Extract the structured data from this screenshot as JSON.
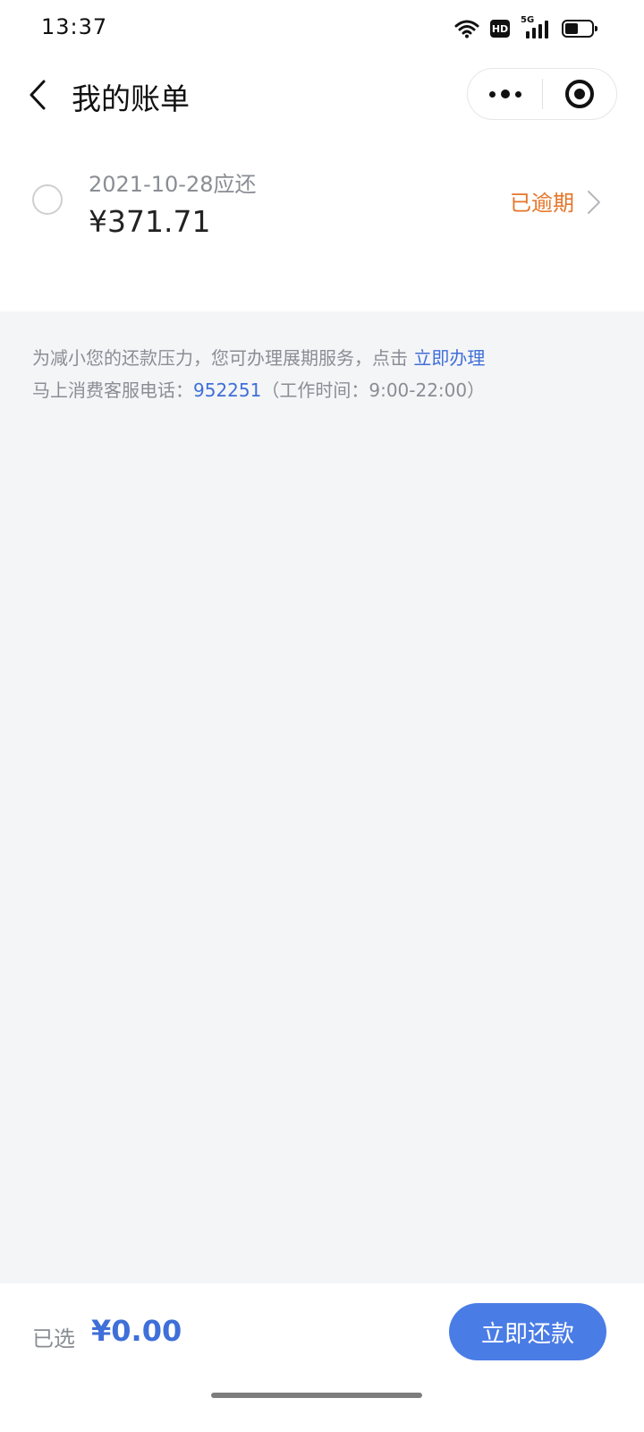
{
  "status_bar": {
    "time": "13:37",
    "icons": [
      "wifi-icon",
      "hd-icon",
      "signal-5g-icon",
      "battery-icon"
    ],
    "hd_label": "HD",
    "network_label": "5G"
  },
  "nav": {
    "title": "我的账单",
    "back_icon": "chevron-left-icon",
    "more_icon": "more-dots-icon",
    "close_icon": "target-close-icon"
  },
  "bill": {
    "due_date": "2021-10-28应还",
    "amount": "¥371.71",
    "status": "已逾期",
    "selected": false
  },
  "notice": {
    "line1_text": "为减小您的还款压力，您可办理展期服务，点击",
    "line1_link": "立即办理",
    "line2_prefix": "马上消费客服电话：",
    "phone": "952251",
    "line2_suffix": "（工作时间：9:00-22:00）"
  },
  "footer": {
    "selected_label": "已选",
    "selected_amount": "¥0.00",
    "pay_button": "立即还款"
  },
  "colors": {
    "accent": "#4a7ce6",
    "link": "#3f6fd8",
    "overdue": "#e5762a",
    "background": "#f4f5f7"
  }
}
